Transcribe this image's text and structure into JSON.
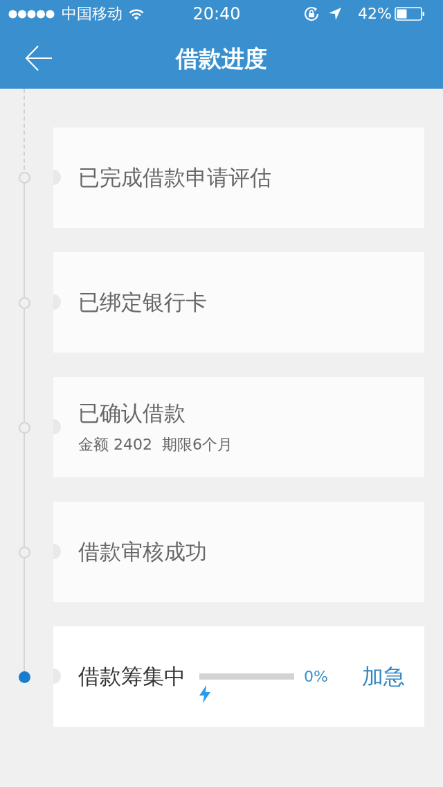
{
  "status_bar": {
    "carrier": "中国移动",
    "time": "20:40",
    "battery": "42%"
  },
  "nav": {
    "title": "借款进度"
  },
  "steps": [
    {
      "title": "已完成借款申请评估",
      "current": false
    },
    {
      "title": "已绑定银行卡",
      "current": false
    },
    {
      "title": "已确认借款",
      "detail": "金额 2402  期限6个月",
      "current": false
    },
    {
      "title": "借款审核成功",
      "current": false
    },
    {
      "title": "借款筹集中",
      "current": true,
      "progress": {
        "level": 0,
        "reading": "0%"
      },
      "action": "加急"
    }
  ]
}
